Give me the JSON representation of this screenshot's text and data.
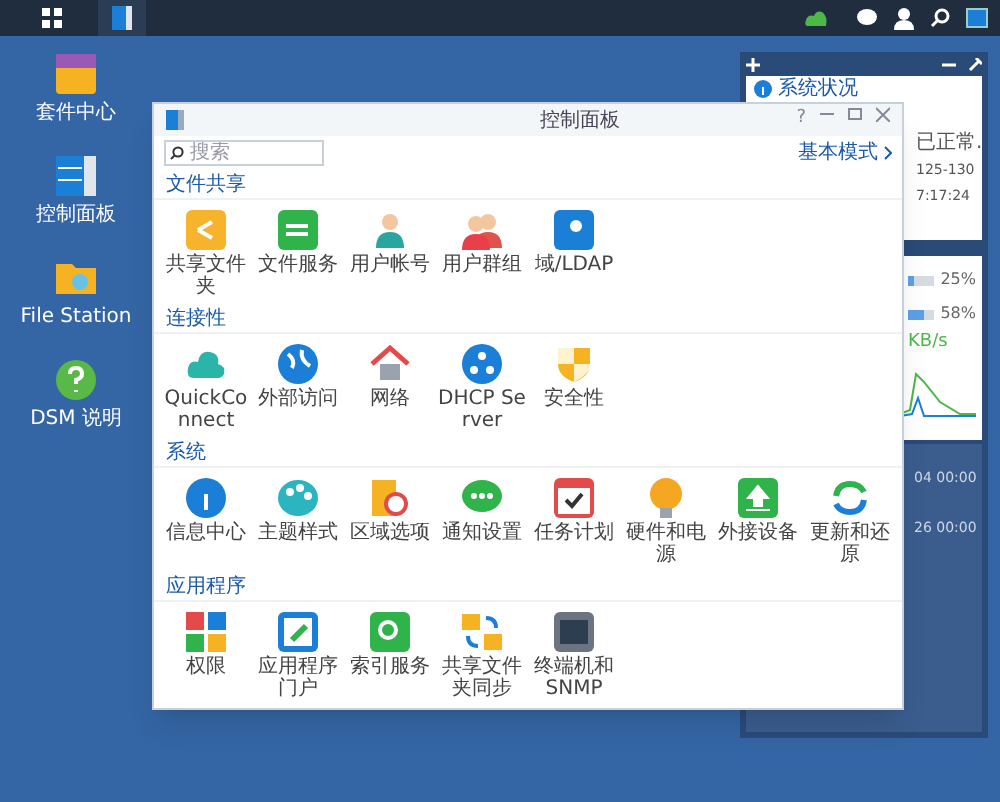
{
  "desktop_icons": [
    {
      "label": "套件中心"
    },
    {
      "label": "控制面板"
    },
    {
      "label": "File Station"
    },
    {
      "label": "DSM 说明"
    }
  ],
  "window": {
    "title": "控制面板",
    "help": "?",
    "search": {
      "placeholder": "搜索"
    },
    "mode_link": "基本模式",
    "sections": [
      {
        "title": "文件共享",
        "items": [
          "共享文件夹",
          "文件服务",
          "用户帐号",
          "用户群组",
          "域/LDAP"
        ]
      },
      {
        "title": "连接性",
        "items": [
          "QuickConnect",
          "外部访问",
          "网络",
          "DHCP Server",
          "安全性"
        ]
      },
      {
        "title": "系统",
        "items": [
          "信息中心",
          "主题样式",
          "区域选项",
          "通知设置",
          "任务计划",
          "硬件和电源",
          "外接设备",
          "更新和还原"
        ]
      },
      {
        "title": "应用程序",
        "items": [
          "权限",
          "应用程序门户",
          "索引服务",
          "共享文件夹同步",
          "终端机和 SNMP"
        ]
      }
    ]
  },
  "widgets": {
    "status": {
      "title": "系统状况",
      "lines": [
        "已正常.",
        "125-130",
        "7:17:24"
      ]
    },
    "resources": {
      "meters": [
        {
          "level": 0.25,
          "reading": "25%"
        },
        {
          "level": 0.58,
          "reading": "58%"
        }
      ],
      "speed": "KB/s"
    },
    "schedule": {
      "lines": [
        "04 00:00",
        "26 00:00"
      ]
    }
  }
}
